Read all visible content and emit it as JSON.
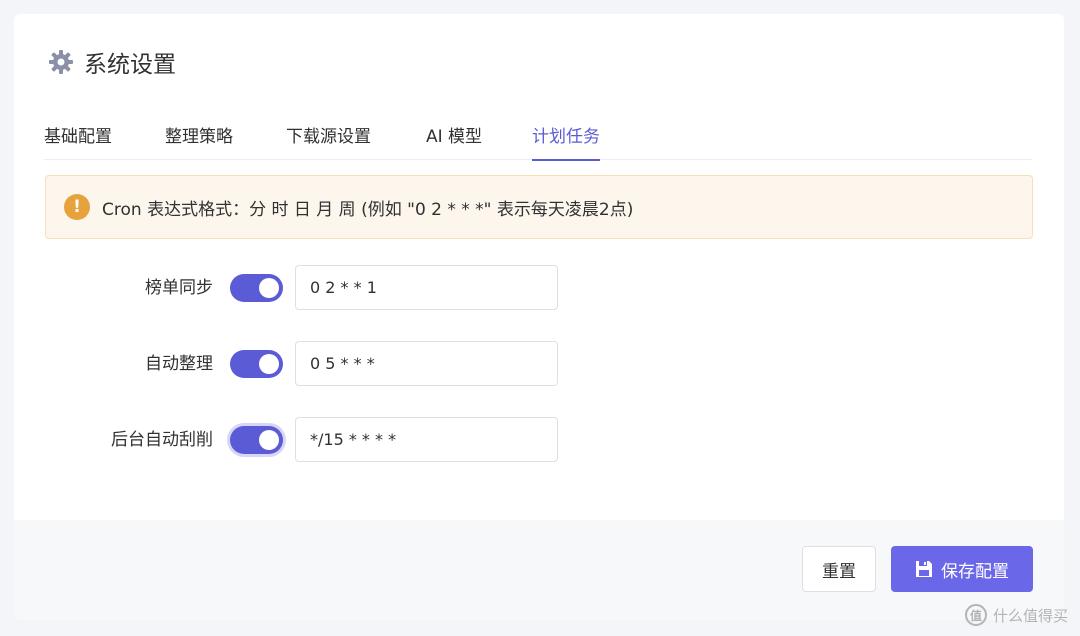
{
  "page": {
    "title": "系统设置",
    "icon": "gear-icon"
  },
  "tabs": [
    {
      "label": "基础配置",
      "active": false
    },
    {
      "label": "整理策略",
      "active": false
    },
    {
      "label": "下载源设置",
      "active": false
    },
    {
      "label": "AI 模型",
      "active": false
    },
    {
      "label": "计划任务",
      "active": true
    }
  ],
  "alert": {
    "icon": "warning-icon",
    "text": "Cron 表达式格式：分 时 日 月 周 (例如 \"0 2 * * *\" 表示每天凌晨2点)"
  },
  "tasks": [
    {
      "label": "榜单同步",
      "enabled": true,
      "cron": "0 2 * * 1"
    },
    {
      "label": "自动整理",
      "enabled": true,
      "cron": "0 5 * * *"
    },
    {
      "label": "后台自动刮削",
      "enabled": true,
      "cron": "*/15 * * * *"
    }
  ],
  "footer": {
    "reset_label": "重置",
    "save_label": "保存配置",
    "save_icon": "floppy-disk-icon"
  },
  "watermark": {
    "text": "什么值得买",
    "logo": "值"
  },
  "colors": {
    "accent": "#5b5bd6",
    "save_button": "#6a67e8",
    "alert_bg": "#fdf6ec",
    "alert_icon": "#e6a23c"
  }
}
